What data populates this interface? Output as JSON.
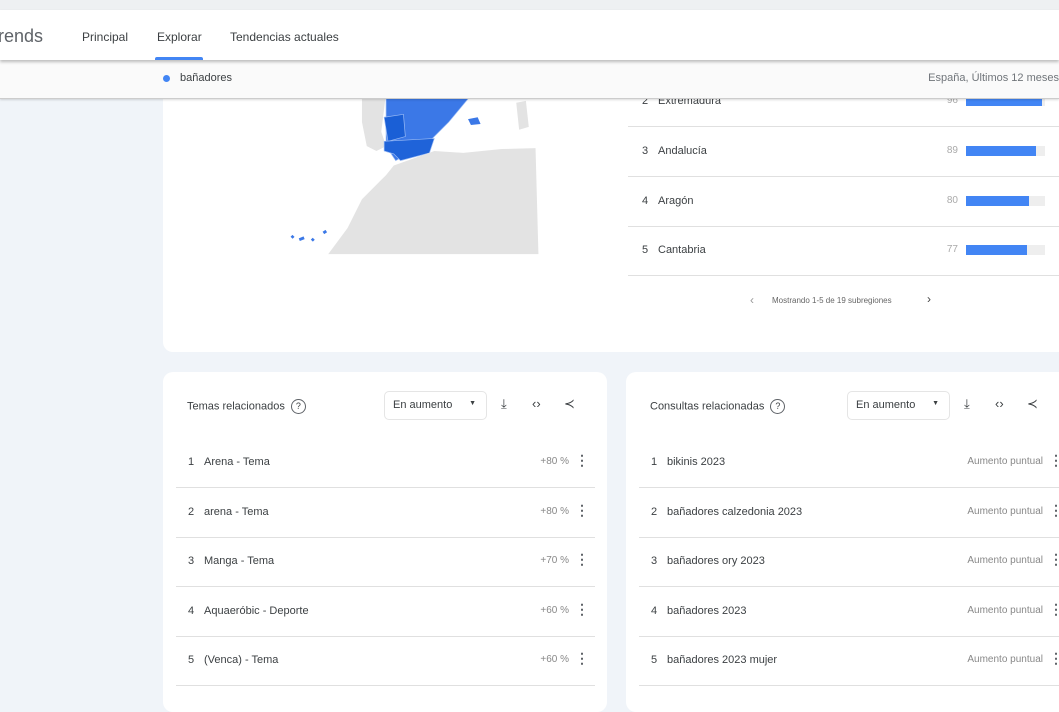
{
  "header": {
    "logo": "rends",
    "nav": [
      "Principal",
      "Explorar",
      "Tendencias actuales"
    ],
    "active_nav": "Explorar"
  },
  "subheader": {
    "term": "bañadores",
    "term_color": "#4285f4",
    "scope": "España, Últimos 12 meses"
  },
  "regions": {
    "rows": [
      {
        "rank": "2",
        "name": "Extremadura",
        "value": "96",
        "percent": 96
      },
      {
        "rank": "3",
        "name": "Andalucía",
        "value": "89",
        "percent": 89
      },
      {
        "rank": "4",
        "name": "Aragón",
        "value": "80",
        "percent": 80
      },
      {
        "rank": "5",
        "name": "Cantabria",
        "value": "77",
        "percent": 77
      }
    ],
    "pager": "Mostrando 1-5 de 19 subregiones",
    "bar_color": "#4285f4"
  },
  "topics": {
    "title": "Temas relacionados",
    "help": "?",
    "filter": "En aumento",
    "rows": [
      {
        "rank": "1",
        "name": "Arena - Tema",
        "value": "+80 %"
      },
      {
        "rank": "2",
        "name": "arena - Tema",
        "value": "+80 %"
      },
      {
        "rank": "3",
        "name": "Manga - Tema",
        "value": "+70 %"
      },
      {
        "rank": "4",
        "name": "Aquaeróbic - Deporte",
        "value": "+60 %"
      },
      {
        "rank": "5",
        "name": "(Venca) - Tema",
        "value": "+60 %"
      }
    ]
  },
  "queries": {
    "title": "Consultas relacionadas",
    "help": "?",
    "filter": "En aumento",
    "rows": [
      {
        "rank": "1",
        "name": "bikinis 2023",
        "value": "Aumento puntual"
      },
      {
        "rank": "2",
        "name": "bañadores calzedonia 2023",
        "value": "Aumento puntual"
      },
      {
        "rank": "3",
        "name": "bañadores ory 2023",
        "value": "Aumento puntual"
      },
      {
        "rank": "4",
        "name": "bañadores 2023",
        "value": "Aumento puntual"
      },
      {
        "rank": "5",
        "name": "bañadores 2023 mujer",
        "value": "Aumento puntual"
      }
    ]
  }
}
